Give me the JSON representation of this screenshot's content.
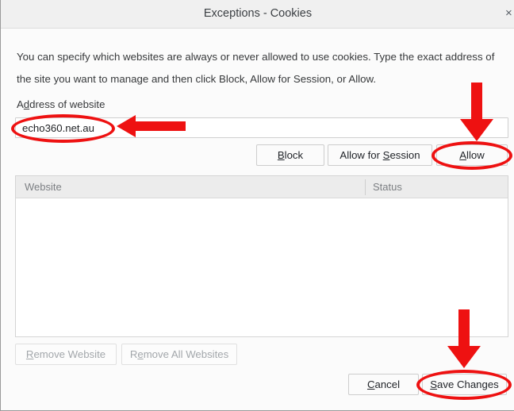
{
  "window": {
    "title": "Exceptions - Cookies",
    "close_icon": "×"
  },
  "description": "You can specify which websites are always or never allowed to use cookies. Type the exact address of the site you want to manage and then click Block, Allow for Session, or Allow.",
  "address": {
    "label_pre": "A",
    "label_key": "d",
    "label_post": "dress of website",
    "label_full": "Address of website",
    "value": "echo360.net.au",
    "placeholder": ""
  },
  "actions": {
    "block": {
      "pre": "",
      "key": "B",
      "post": "lock"
    },
    "allow_for_session": {
      "pre": "Allow for ",
      "key": "S",
      "post": "ession"
    },
    "allow": {
      "pre": "",
      "key": "A",
      "post": "llow"
    }
  },
  "list": {
    "columns": [
      "Website",
      "Status"
    ],
    "rows": []
  },
  "remove": {
    "remove_website": {
      "pre": "",
      "key": "R",
      "post": "emove Website"
    },
    "remove_all_websites": {
      "pre": "R",
      "key": "e",
      "post": "move All Websites"
    }
  },
  "footer": {
    "cancel": {
      "pre": "",
      "key": "C",
      "post": "ancel"
    },
    "save_changes": {
      "pre": "",
      "key": "S",
      "post": "ave Changes"
    }
  },
  "annotations": {
    "color": "#ee1111",
    "highlights": [
      "address-field",
      "allow-button",
      "save-changes-button"
    ],
    "arrows": [
      "arrow-to-address-field",
      "arrow-to-allow-button",
      "arrow-to-save-changes-button"
    ]
  }
}
